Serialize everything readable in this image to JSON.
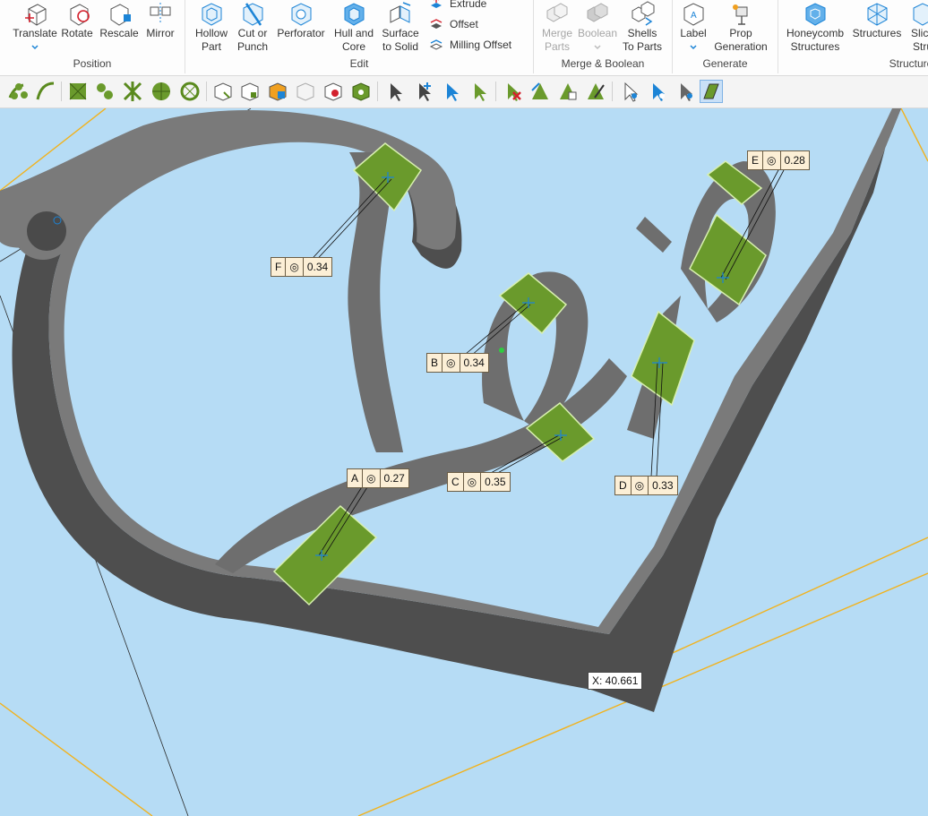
{
  "ribbon": {
    "position": {
      "label": "Position",
      "buttons": [
        {
          "label": "Translate",
          "icon": "translate-icon"
        },
        {
          "label": "Rotate",
          "icon": "rotate-icon"
        },
        {
          "label": "Rescale",
          "icon": "rescale-icon"
        },
        {
          "label": "Mirror",
          "icon": "mirror-icon"
        }
      ]
    },
    "edit": {
      "label": "Edit",
      "buttons": [
        {
          "label": "Hollow\nPart",
          "icon": "hollow-part-icon"
        },
        {
          "label": "Cut or\nPunch",
          "icon": "cut-punch-icon"
        },
        {
          "label": "Perforator",
          "icon": "perforator-icon"
        },
        {
          "label": "Hull and\nCore",
          "icon": "hull-core-icon"
        },
        {
          "label": "Surface\nto Solid",
          "icon": "surface-solid-icon"
        }
      ],
      "small_buttons": [
        {
          "label": "Extrude",
          "icon": "extrude-icon"
        },
        {
          "label": "Offset",
          "icon": "offset-icon"
        },
        {
          "label": "Milling Offset",
          "icon": "milling-offset-icon"
        }
      ]
    },
    "merge": {
      "label": "Merge & Boolean",
      "buttons": [
        {
          "label": "Merge\nParts",
          "icon": "merge-parts-icon",
          "disabled": true
        },
        {
          "label": "Boolean",
          "icon": "boolean-icon",
          "disabled": true
        },
        {
          "label": "Shells\nTo Parts",
          "icon": "shells-parts-icon"
        }
      ]
    },
    "generate": {
      "label": "Generate",
      "buttons": [
        {
          "label": "Label",
          "icon": "label-icon"
        },
        {
          "label": "Prop\nGeneration",
          "icon": "prop-generation-icon"
        }
      ]
    },
    "structures": {
      "label": "Structures",
      "buttons": [
        {
          "label": "Honeycomb\nStructures",
          "icon": "honeycomb-icon"
        },
        {
          "label": "Structures",
          "icon": "structures-icon"
        },
        {
          "label": "Slice\nStru",
          "icon": "slice-icon"
        }
      ]
    }
  },
  "annotations": [
    {
      "letter": "F",
      "symbol": "◎",
      "value": "0.34"
    },
    {
      "letter": "B",
      "symbol": "◎",
      "value": "0.34"
    },
    {
      "letter": "A",
      "symbol": "◎",
      "value": "0.27"
    },
    {
      "letter": "C",
      "symbol": "◎",
      "value": "0.35"
    },
    {
      "letter": "D",
      "symbol": "◎",
      "value": "0.33"
    },
    {
      "letter": "E",
      "symbol": "◎",
      "value": "0.28"
    }
  ],
  "x_readout": "X: 40.661",
  "colors": {
    "viewport": "#b6dcf5",
    "part_top": "#737373",
    "part_side": "#4d4d4d",
    "prop_fill": "#6a9a2c",
    "prop_outline": "#d8f0b0",
    "guide": "#f2b21c",
    "accent": "#1c84d6"
  }
}
